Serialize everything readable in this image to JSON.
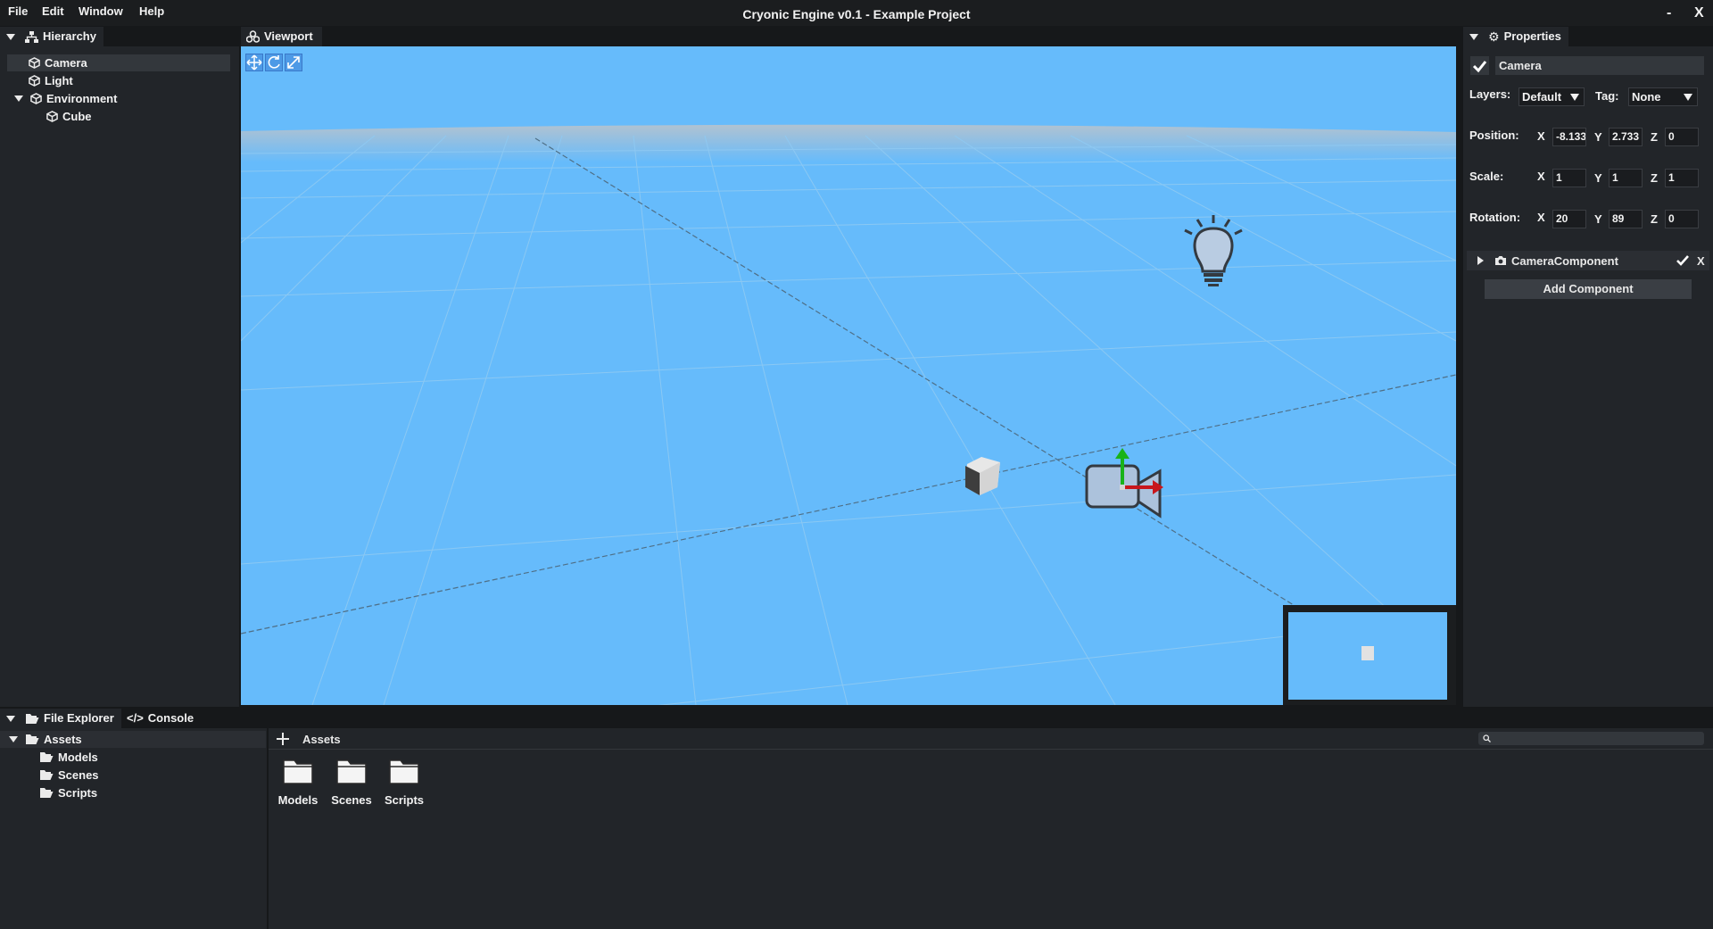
{
  "menubar": {
    "items": [
      "File",
      "Edit",
      "Window",
      "Help"
    ],
    "title": "Cryonic Engine v0.1 - Example Project",
    "minimize": "-",
    "close": "X"
  },
  "hierarchy": {
    "title": "Hierarchy",
    "items": [
      {
        "label": "Camera",
        "selected": true
      },
      {
        "label": "Light"
      },
      {
        "label": "Environment",
        "expanded": true
      },
      {
        "label": "Cube",
        "child": true
      }
    ]
  },
  "viewport": {
    "title": "Viewport",
    "tools": [
      "move-tool-icon",
      "rotate-tool-icon",
      "scale-tool-icon"
    ],
    "sky_color": "#66bbfb"
  },
  "properties": {
    "title": "Properties",
    "enabled": true,
    "object_name": "Camera",
    "layers_label": "Layers:",
    "layers_value": "Default",
    "tag_label": "Tag:",
    "tag_value": "None",
    "position": {
      "label": "Position:",
      "x": "-8.133",
      "y": "2.733",
      "z": "0"
    },
    "scale": {
      "label": "Scale:",
      "x": "1",
      "y": "1",
      "z": "1"
    },
    "rotation": {
      "label": "Rotation:",
      "x": "20",
      "y": "89",
      "z": "0"
    },
    "axis_x": "X",
    "axis_y": "Y",
    "axis_z": "Z",
    "component": {
      "name": "CameraComponent",
      "remove": "X"
    },
    "add_component": "Add Component"
  },
  "bottom": {
    "tabs": [
      "File Explorer",
      "Console"
    ],
    "tree": {
      "root": "Assets",
      "children": [
        "Models",
        "Scenes",
        "Scripts"
      ]
    },
    "breadcrumb": "Assets",
    "search_placeholder": "",
    "assets": [
      "Models",
      "Scenes",
      "Scripts"
    ]
  }
}
